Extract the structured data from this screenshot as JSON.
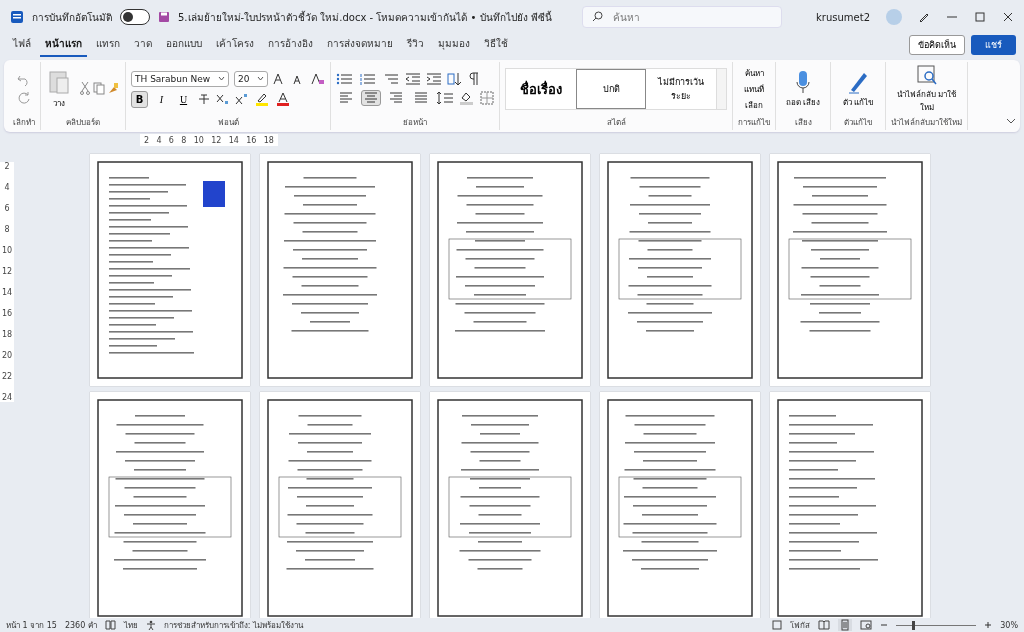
{
  "title_bar": {
    "autosave_label": "การบันทึกอัตโนมัติ",
    "autosave_on": false,
    "file_name": "5.เล่มย้ายใหม่-ใบปรหน้าตัวชี้วัด ใหม่.docx  -  โหมดความเข้ากันได้ • บันทึกไปยัง พีซีนี้",
    "search_placeholder": "ค้นหา",
    "user_name": "krusumet2"
  },
  "tabs": [
    {
      "label": "ไฟล์",
      "selected": false
    },
    {
      "label": "หน้าแรก",
      "selected": true
    },
    {
      "label": "แทรก",
      "selected": false
    },
    {
      "label": "วาด",
      "selected": false
    },
    {
      "label": "ออกแบบ",
      "selected": false
    },
    {
      "label": "เค้าโครง",
      "selected": false
    },
    {
      "label": "การอ้างอิง",
      "selected": false
    },
    {
      "label": "การส่งจดหมาย",
      "selected": false
    },
    {
      "label": "รีวิว",
      "selected": false
    },
    {
      "label": "มุมมอง",
      "selected": false
    },
    {
      "label": "วิธีใช้",
      "selected": false
    }
  ],
  "comment_button": "ข้อคิดเห็น",
  "share_button": "แชร์",
  "ribbon": {
    "undo_label": "เลิกทำ",
    "paste_label": "วาง",
    "clipboard_label": "คลิปบอร์ด",
    "font_name": "TH Sarabun New",
    "font_size": "20",
    "font_buttons": [
      {
        "label": "B",
        "selected": true
      },
      {
        "label": "I",
        "selected": false
      },
      {
        "label": "U",
        "selected": false
      }
    ],
    "font_label": "ฟอนต์",
    "align_buttons": [
      {
        "selected": false
      },
      {
        "selected": true
      },
      {
        "selected": false
      },
      {
        "selected": false
      }
    ],
    "paragraph_label": "ย่อหน้า",
    "styles": [
      {
        "label": "ชื่อเรื่อง",
        "selected": false
      },
      {
        "label": "ปกติ",
        "selected": true
      },
      {
        "label": "ไม่มีการเว้นระยะ",
        "selected": false
      }
    ],
    "styles_label": "สไตล์",
    "editing": [
      "ค้นหา",
      "แทนที่",
      "เลือก"
    ],
    "editing_label": "การแก้ไข",
    "dictate": "ถอด เสียง",
    "voice_label": "เสียง",
    "editor": "ตัว แก้ไข",
    "editor_label": "ตัวแก้ไข",
    "reuse": "นำไฟล์กลับ มาใช้ใหม่",
    "reuse_label": "นำไฟล์กลับมาใช้ใหม่"
  },
  "ruler_numbers": [
    "2",
    "4",
    "6",
    "8",
    "10",
    "12",
    "14",
    "16",
    "18"
  ],
  "vertical_ruler_numbers": [
    "2",
    "4",
    "6",
    "8",
    "10",
    "12",
    "14",
    "16",
    "18",
    "20",
    "22",
    "24"
  ],
  "status_bar": {
    "page": "หน้า 1 จาก 15",
    "words": "2360 คำ",
    "language": "ไทย",
    "accessibility": "การช่วยสำหรับการเข้าถึง: ไม่พร้อมใช้งาน",
    "focus": "โฟกัส",
    "zoom": "30%",
    "zoom_slider": {
      "level": 0.2
    }
  }
}
